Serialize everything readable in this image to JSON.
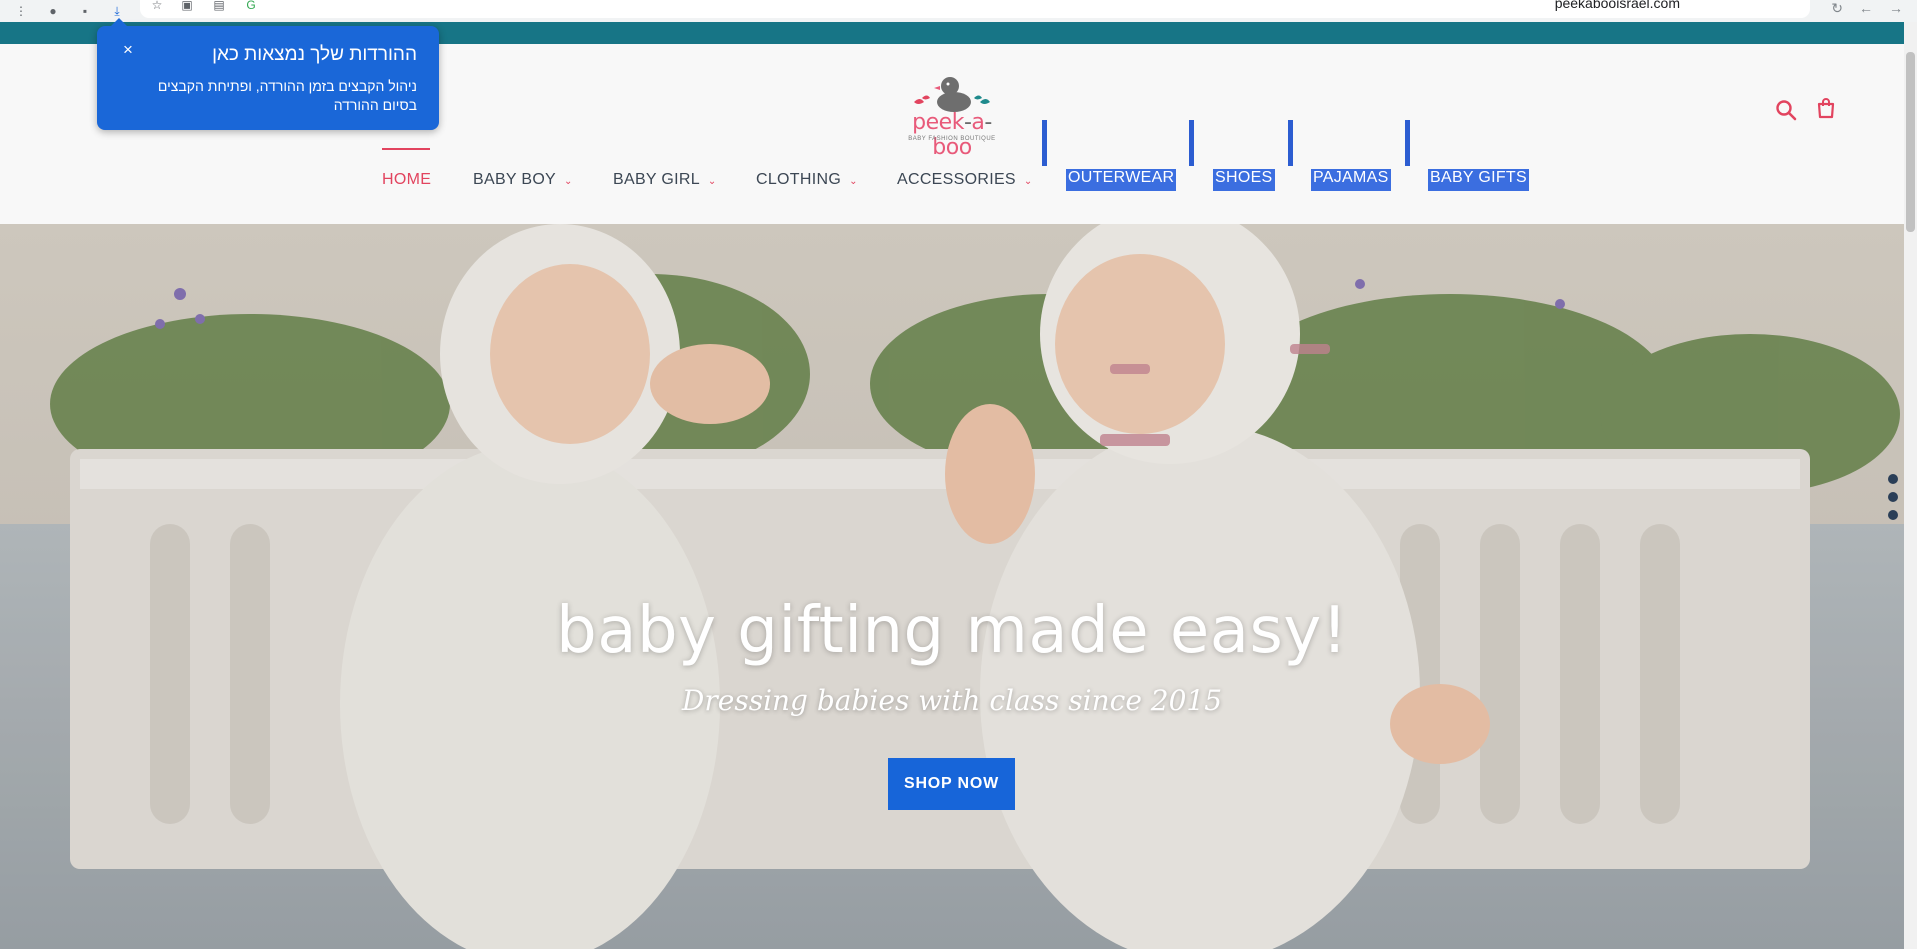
{
  "browser": {
    "url": "peekabooisrael.com",
    "icons": [
      "more-vert-icon",
      "profile-icon",
      "extension-icon",
      "download-icon",
      "star-icon",
      "screenshot-icon",
      "media-icon",
      "google-icon"
    ]
  },
  "download_popup": {
    "title": "ההורדות שלך נמצאות כאן",
    "body": "ניהול הקבצים בזמן ההורדה, ופתיחת הקבצים בסיום ההורדה",
    "close": "×"
  },
  "logo": {
    "word_part1": "peek",
    "word_dash1": "-",
    "word_part2": "a",
    "word_dash2": "-",
    "word_part3": "boo",
    "tagline": "BABY FASHION BOUTIQUE"
  },
  "nav": {
    "items": [
      {
        "label": "HOME",
        "active": true,
        "dropdown": false
      },
      {
        "label": "BABY BOY",
        "dropdown": true
      },
      {
        "label": "BABY GIRL",
        "dropdown": true
      },
      {
        "label": "CLOTHING",
        "dropdown": true
      },
      {
        "label": "ACCESSORIES",
        "dropdown": true
      },
      {
        "label": "OUTERWEAR",
        "highlighted": true
      },
      {
        "label": "SHOES",
        "highlighted": true
      },
      {
        "label": "PAJAMAS",
        "highlighted": true
      },
      {
        "label": "BABY GIFTS",
        "highlighted": true
      }
    ],
    "chevron": "⌄"
  },
  "hero": {
    "title": "baby gifting made easy!",
    "subtitle": "Dressing babies with class since 2015",
    "button": "SHOP NOW"
  },
  "colors": {
    "teal_bar": "#177586",
    "accent_pink": "#e2445f",
    "button_blue": "#1765d9",
    "popup_blue": "#1a67d8",
    "selection_blue": "#3b6ee0"
  }
}
